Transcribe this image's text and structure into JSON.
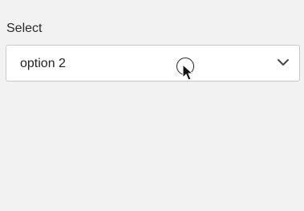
{
  "field": {
    "label": "Select",
    "selected_value": "option 2"
  },
  "icons": {
    "dropdown": "chevron-down-icon",
    "cursor": "mouse-pointer-icon"
  },
  "colors": {
    "background": "#f2f2f2",
    "border": "#c9c9c9",
    "text": "#222222"
  }
}
